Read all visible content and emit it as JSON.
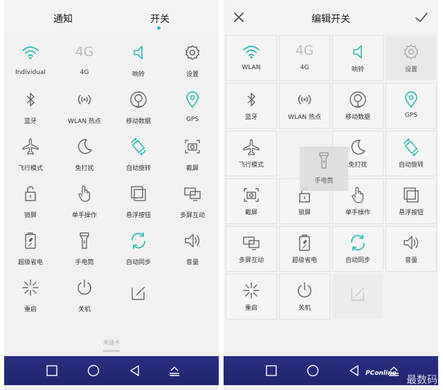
{
  "colors": {
    "accent": "#2cbcb6",
    "icon_gray": "#666666",
    "nav_bg": "#2a2f80"
  },
  "left": {
    "tabs": [
      "通知",
      "开关"
    ],
    "active_tab": "开关",
    "toggles": [
      "Individual",
      "4G",
      "响铃",
      "设置",
      "蓝牙",
      "WLAN 热点",
      "移动数据",
      "GPS",
      "飞行模式",
      "免打扰",
      "自动旋转",
      "截屏",
      "锁屏",
      "单手操作",
      "悬浮按钮",
      "多屏互动",
      "超级省电",
      "手电筒",
      "自动同步",
      "音量",
      "重启",
      "关机"
    ],
    "sim_status": "未插卡"
  },
  "right": {
    "title": "编辑开关",
    "toggles": [
      "WLAN",
      "4G",
      "响铃",
      "设置",
      "蓝牙",
      "WLAN 热点",
      "移动数据",
      "GPS",
      "飞行模式",
      "免打扰",
      "自动旋转",
      "截屏",
      "锁屏",
      "单手操作",
      "悬浮按钮",
      "多屏互动",
      "超级省电",
      "自动同步",
      "音量",
      "重启",
      "关机"
    ],
    "dragging": "手电筒"
  },
  "text_4g": "4G",
  "watermark": {
    "site": "PConline",
    "big": "最数码"
  }
}
